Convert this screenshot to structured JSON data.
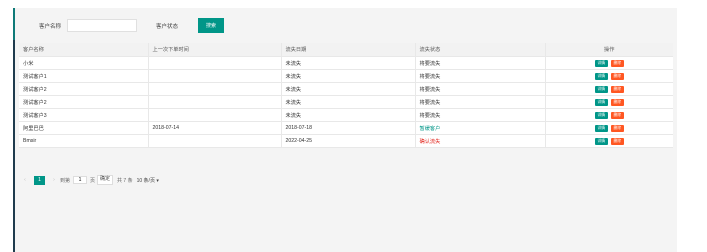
{
  "search": {
    "name_label": "客户名称",
    "name_value": "",
    "status_label": "客户状态",
    "status_value": "",
    "button_label": "搜索"
  },
  "table": {
    "headers": [
      "客户名称",
      "上一次下单时间",
      "流失日期",
      "流失状态",
      "操作"
    ],
    "rows": [
      {
        "name": "小米",
        "last_order": "",
        "lost_date": "未流失",
        "status": "将要流失",
        "status_color": "default"
      },
      {
        "name": "测试客户1",
        "last_order": "",
        "lost_date": "未流失",
        "status": "将要流失",
        "status_color": "default"
      },
      {
        "name": "测试客户2",
        "last_order": "",
        "lost_date": "未流失",
        "status": "将要流失",
        "status_color": "default"
      },
      {
        "name": "测试客户2",
        "last_order": "",
        "lost_date": "未流失",
        "status": "将要流失",
        "status_color": "default"
      },
      {
        "name": "测试客户3",
        "last_order": "",
        "lost_date": "未流失",
        "status": "将要流失",
        "status_color": "default"
      },
      {
        "name": "阿里巴巴",
        "last_order": "2018-07-14",
        "lost_date": "2018-07-18",
        "status": "暂缓客户",
        "status_color": "#009688"
      },
      {
        "name": "Bmsir",
        "last_order": "",
        "lost_date": "2022-04-25",
        "status": "确认流失",
        "status_color": "#e2231a"
      }
    ],
    "detail_label": "详情",
    "delete_label": "删除"
  },
  "pager": {
    "prev": "‹",
    "current_page": "1",
    "next": "›",
    "goto_label": "到第",
    "goto_value": "1",
    "page_unit": "页",
    "confirm_label": "确定",
    "total_label": "共 7 条",
    "page_size_label": "10 条/页",
    "dropdown_glyph": "▾"
  },
  "colors": {
    "accent": "#009688",
    "danger": "#ff5722",
    "sidebar": "#1f3b4d"
  }
}
